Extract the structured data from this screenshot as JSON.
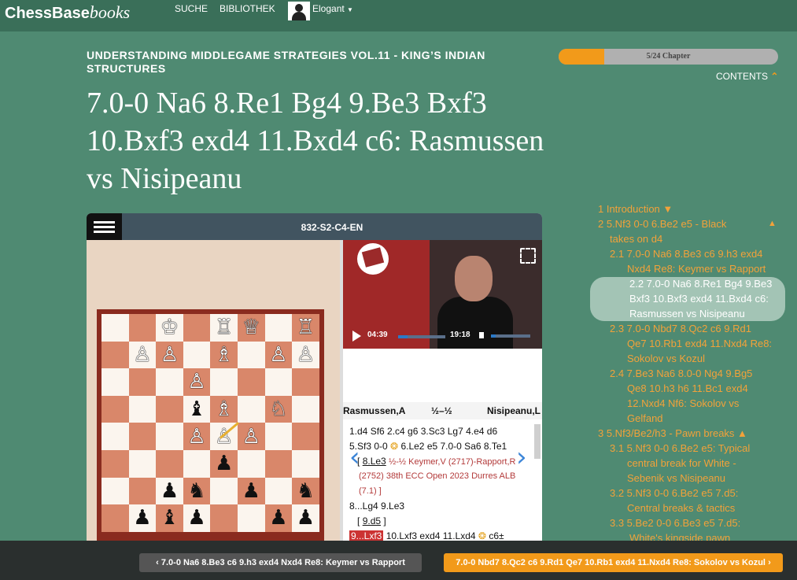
{
  "header": {
    "brand": "ChessBase",
    "brand_suffix": "books",
    "nav": [
      "SUCHE",
      "BIBLIOTHEK"
    ],
    "user": "Elogant"
  },
  "book": {
    "series_title": "UNDERSTANDING MIDDLEGAME STRATEGIES VOL.11 - KING’S INDIAN STRUCTURES",
    "chapter_title": "7.0-0 Na6 8.Re1 Bg4 9.Be3 Bxf3 10.Bxf3 exd4 11.Bxd4 c6: Rasmussen vs Nisipeanu"
  },
  "progress": {
    "label": "5/24 Chapter",
    "fraction": 0.2083
  },
  "contents_label": "CONTENTS",
  "viewer": {
    "id": "832-S2-C4-EN",
    "video": {
      "current": "04:39",
      "duration": "19:18"
    },
    "players": {
      "white": "Rasmussen,A",
      "result": "½–½",
      "black": "Nisipeanu,L"
    },
    "notation": {
      "l1": "1.d4 Sf6 2.c4 g6 3.Sc3 Lg7 4.e4 d6",
      "l2a": "5.Sf3 0-0",
      "l2b": "6.Le2 e5 7.0-0 Sa6 8.Te1",
      "l3a": "[",
      "l3b": "8.Le3",
      "l3c": "½-½ Keymer,V (2717)-Rapport,R",
      "l4": "(2752) 38th ECC Open 2023 Durres ALB",
      "l5": "(7.1) ]",
      "l6": "8...Lg4 9.Le3",
      "l7a": "[",
      "l7b": "9.d5",
      "l7c": "]",
      "l8a": "9...Lxf3",
      "l8b": "10.Lxf3 exd4 11.Lxd4",
      "l8c": "c6±"
    }
  },
  "board": {
    "rows": [
      [
        "",
        "",
        "♔",
        "",
        "♖",
        "♕",
        "",
        "♖"
      ],
      [
        "",
        "♙",
        "♙",
        "",
        "♗",
        "",
        "♙",
        "♙"
      ],
      [
        "",
        "",
        "",
        "♙",
        "",
        "",
        "",
        ""
      ],
      [
        "",
        "",
        "",
        "♝",
        "♗",
        "",
        "♘",
        ""
      ],
      [
        "",
        "",
        "",
        "♙",
        "♙",
        "♙",
        "",
        ""
      ],
      [
        "",
        "",
        "",
        "",
        "♟",
        "",
        "",
        ""
      ],
      [
        "",
        "",
        "♟",
        "♞",
        "",
        "♟",
        "",
        "♞"
      ],
      [
        "",
        "♟",
        "♝",
        "♟",
        "",
        "",
        "♟",
        "♟"
      ],
      [
        "",
        "",
        "♚",
        "♜",
        "",
        "♛",
        "",
        "♜"
      ]
    ]
  },
  "toc": {
    "items": [
      {
        "label": "1  Introduction  ▼"
      },
      {
        "label": "2  5.Nf3 0-0 6.Be2 e5 - Black"
      },
      {
        "label": "takes on d4"
      },
      {
        "label": "2.1  7.0-0 Na6 8.Be3 c6 9.h3 exd4"
      },
      {
        "label": "Nxd4 Re8: Keymer vs Rapport"
      },
      {
        "label": "2.2  7.0-0 Na6 8.Re1 Bg4 9.Be3"
      },
      {
        "label": "Bxf3 10.Bxf3 exd4 11.Bxd4 c6:"
      },
      {
        "label": "Rasmussen vs Nisipeanu"
      },
      {
        "label": "2.3  7.0-0 Nbd7 8.Qc2 c6 9.Rd1"
      },
      {
        "label": "Qe7 10.Rb1 exd4 11.Nxd4 Re8:"
      },
      {
        "label": "Sokolov vs Kozul"
      },
      {
        "label": "2.4  7.Be3 Na6 8.0-0 Ng4 9.Bg5"
      },
      {
        "label": "Qe8 10.h3 h6 11.Bc1 exd4"
      },
      {
        "label": "12.Nxd4 Nf6: Sokolov vs"
      },
      {
        "label": "Gelfand"
      },
      {
        "label": "3  5.Nf3/Be2/h3 - Pawn breaks  ▲"
      },
      {
        "label": "3.1  5.Nf3 0-0 6.Be2 e5: Typical"
      },
      {
        "label": "central break for White -"
      },
      {
        "label": "Sebenik vs Nisipeanu"
      },
      {
        "label": "3.2  5.Nf3 0-0 6.Be2 e5 7.d5:"
      },
      {
        "label": "Central breaks & tactics"
      },
      {
        "label": "3.3  5.Be2 0-0 6.Be3 e5 7.d5:"
      },
      {
        "label": "White's kingside pawn"
      }
    ],
    "section2_toggle": "▲"
  },
  "footer": {
    "prev": "7.0-0 Na6 8.Be3 c6 9.h3 exd4 Nxd4 Re8: Keymer vs Rapport",
    "next": "7.0-0 Nbd7 8.Qc2 c6 9.Rd1 Qe7 10.Rb1 exd4 11.Nxd4 Re8: Sokolov vs Kozul"
  },
  "colors": {
    "background": "#4f8a72",
    "accent": "#f29a1a",
    "topbar": "#3a6f59"
  }
}
